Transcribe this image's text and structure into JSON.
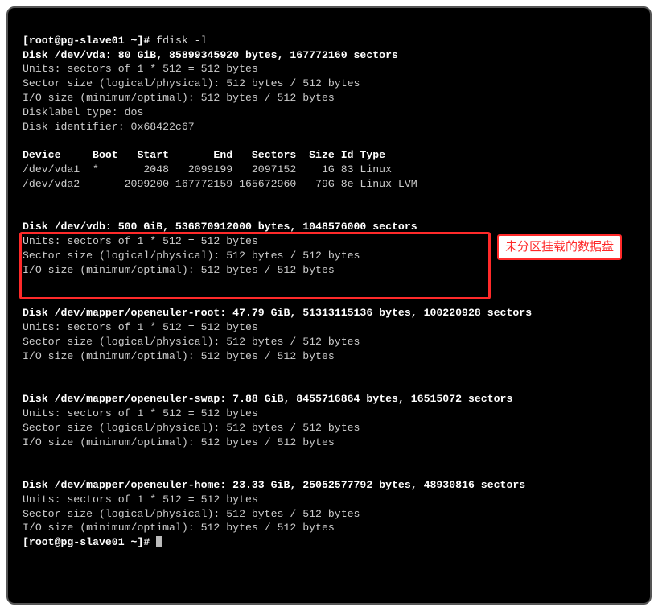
{
  "prompt1": {
    "user_host_path": "[root@pg-slave01 ~]# ",
    "command": "fdisk -l"
  },
  "vda": {
    "header": "Disk /dev/vda: 80 GiB, 85899345920 bytes, 167772160 sectors",
    "units": "Units: sectors of 1 * 512 = 512 bytes",
    "sector": "Sector size (logical/physical): 512 bytes / 512 bytes",
    "io": "I/O size (minimum/optimal): 512 bytes / 512 bytes",
    "dlt": "Disklabel type: dos",
    "did": "Disk identifier: 0x68422c67"
  },
  "part_table": {
    "header": "Device     Boot   Start       End   Sectors  Size Id Type",
    "rows": [
      "/dev/vda1  *       2048   2099199   2097152    1G 83 Linux",
      "/dev/vda2       2099200 167772159 165672960   79G 8e Linux LVM"
    ]
  },
  "vdb": {
    "header": "Disk /dev/vdb: 500 GiB, 536870912000 bytes, 1048576000 sectors",
    "units": "Units: sectors of 1 * 512 = 512 bytes",
    "sector": "Sector size (logical/physical): 512 bytes / 512 bytes",
    "io": "I/O size (minimum/optimal): 512 bytes / 512 bytes"
  },
  "mapper_root": {
    "header": "Disk /dev/mapper/openeuler-root: 47.79 GiB, 51313115136 bytes, 100220928 sectors",
    "units": "Units: sectors of 1 * 512 = 512 bytes",
    "sector": "Sector size (logical/physical): 512 bytes / 512 bytes",
    "io": "I/O size (minimum/optimal): 512 bytes / 512 bytes"
  },
  "mapper_swap": {
    "header": "Disk /dev/mapper/openeuler-swap: 7.88 GiB, 8455716864 bytes, 16515072 sectors",
    "units": "Units: sectors of 1 * 512 = 512 bytes",
    "sector": "Sector size (logical/physical): 512 bytes / 512 bytes",
    "io": "I/O size (minimum/optimal): 512 bytes / 512 bytes"
  },
  "mapper_home": {
    "header": "Disk /dev/mapper/openeuler-home: 23.33 GiB, 25052577792 bytes, 48930816 sectors",
    "units": "Units: sectors of 1 * 512 = 512 bytes",
    "sector": "Sector size (logical/physical): 512 bytes / 512 bytes",
    "io": "I/O size (minimum/optimal): 512 bytes / 512 bytes"
  },
  "prompt2": {
    "user_host_path": "[root@pg-slave01 ~]# "
  },
  "annotation": {
    "label": "未分区挂载的数据盘"
  }
}
